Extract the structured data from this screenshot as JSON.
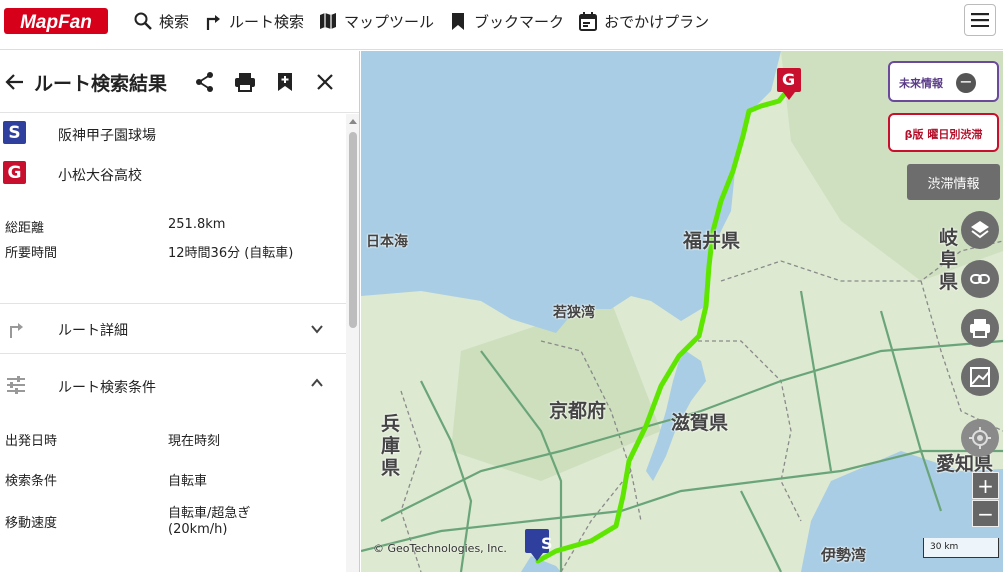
{
  "header": {
    "logo_text": "MapFan",
    "nav": [
      {
        "label": "検索",
        "icon": "search-icon"
      },
      {
        "label": "ルート検索",
        "icon": "route-turn-icon"
      },
      {
        "label": "マップツール",
        "icon": "map-icon"
      },
      {
        "label": "ブックマーク",
        "icon": "bookmark-icon"
      },
      {
        "label": "おでかけプラン",
        "icon": "calendar-icon"
      }
    ],
    "menu_icon": "hamburger-icon"
  },
  "panel": {
    "title": "ルート検索結果",
    "icons": [
      "share-icon",
      "print-icon",
      "bookmark-add-icon",
      "close-icon"
    ],
    "start": {
      "mark": "S",
      "name": "阪神甲子園球場"
    },
    "goal": {
      "mark": "G",
      "name": "小松大谷高校"
    },
    "summary": {
      "distance_label": "総距離",
      "distance_value": "251.8km",
      "time_label": "所要時間",
      "time_value": "12時間36分 (自転車)"
    },
    "sections": {
      "detail_label": "ルート詳細",
      "conditions_label": "ルート検索条件"
    },
    "conditions": {
      "departure_label": "出発日時",
      "departure_value": "現在時刻",
      "search_label": "検索条件",
      "search_value": "自転車",
      "speed_label": "移動速度",
      "speed_value_1": "自転車/超急ぎ",
      "speed_value_2": "(20km/h)"
    }
  },
  "map": {
    "labels": {
      "sea_of_japan": "日本海",
      "wakasa_bay": "若狭湾",
      "fukui": "福井県",
      "gifu_1": "岐",
      "gifu_2": "阜",
      "gifu_3": "県",
      "kyoto": "京都府",
      "shiga": "滋賀県",
      "hyogo_1": "兵",
      "hyogo_2": "庫",
      "hyogo_3": "県",
      "aichi": "愛知県",
      "ise_bay": "伊勢湾"
    },
    "copyright": "© GeoTechnologies, Inc.",
    "scale": "30 km",
    "future_info": "未来情報",
    "beta_jam": "β版 曜日別渋滞",
    "jam_info": "渋滞情報",
    "controls": [
      "layers-icon",
      "link-icon",
      "print-icon",
      "terrain-icon",
      "locate-icon"
    ],
    "zoom_in": "+",
    "zoom_out": "−",
    "marker_start": "S",
    "marker_goal": "G",
    "route_color": "#5ee600"
  }
}
